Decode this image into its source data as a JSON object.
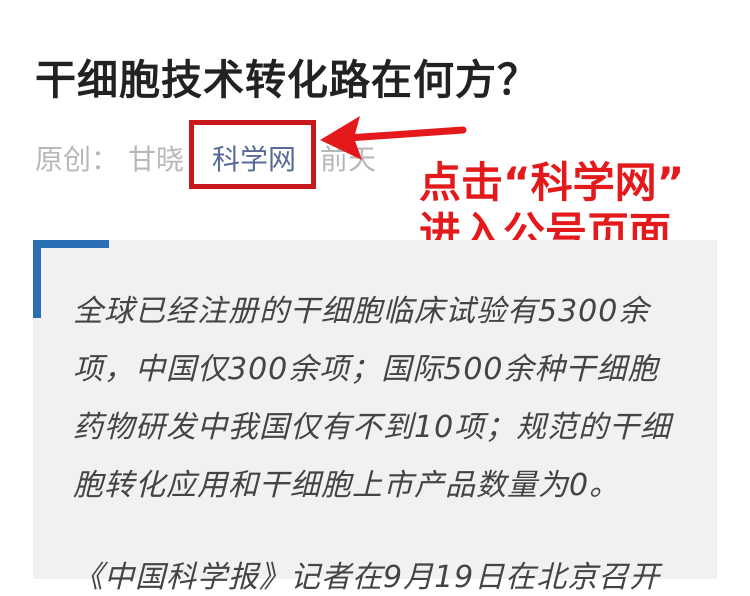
{
  "article": {
    "title": "干细胞技术转化路在何方？",
    "meta": {
      "original_label": "原创：",
      "author": "甘晓",
      "source": "科学网",
      "date": "前天"
    }
  },
  "annotation": {
    "line1": "点击“科学网”",
    "line2": "进入公号页面",
    "color": "#e4191b"
  },
  "quote": {
    "lines": [
      "全球已经注册的干细胞临床试验有5300余",
      "项，中国仅300余项；国际500余种干细胞",
      "药物研发中我国仅有不到10项；规范的干细",
      "胞转化应用和干细胞上市产品数量为0。"
    ],
    "next_line": "《中国科学报》记者在9月19日在北京召开"
  },
  "colors": {
    "accent_bar": "#2a6fb3",
    "highlight": "#c7191c",
    "link": "#576b95"
  }
}
